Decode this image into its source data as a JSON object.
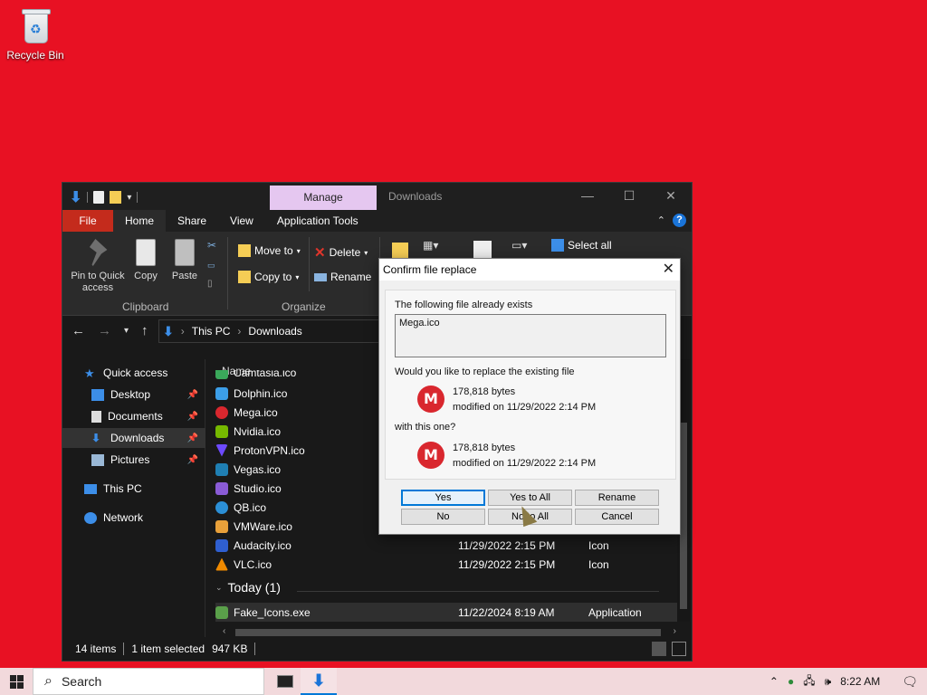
{
  "desktop": {
    "recycle_bin_label": "Recycle Bin",
    "background_color": "#e81123"
  },
  "explorer": {
    "title": "Downloads",
    "manage_tab": "Manage",
    "tabs": [
      "File",
      "Home",
      "Share",
      "View",
      "Application Tools"
    ],
    "ribbon": {
      "pin_label": "Pin to Quick access",
      "copy_label": "Copy",
      "paste_label": "Paste",
      "move_to": "Move to",
      "copy_to": "Copy to",
      "delete": "Delete",
      "rename": "Rename",
      "select_all": "Select all",
      "clipboard_group": "Clipboard",
      "organize_group": "Organize"
    },
    "address": {
      "segments": [
        "This PC",
        "Downloads"
      ]
    },
    "sidebar": {
      "items": [
        {
          "label": "Quick access",
          "icon": "star-icon"
        },
        {
          "label": "Desktop",
          "icon": "desktop-icon"
        },
        {
          "label": "Documents",
          "icon": "documents-icon"
        },
        {
          "label": "Downloads",
          "icon": "download-icon"
        },
        {
          "label": "Pictures",
          "icon": "pictures-icon"
        },
        {
          "label": "This PC",
          "icon": "computer-icon"
        },
        {
          "label": "Network",
          "icon": "network-icon"
        }
      ]
    },
    "list": {
      "column_name": "Name",
      "partial_item": "Camtasia.ico",
      "files": [
        {
          "name": "Dolphin.ico",
          "date": "",
          "type": ""
        },
        {
          "name": "Mega.ico",
          "date": "",
          "type": ""
        },
        {
          "name": "Nvidia.ico",
          "date": "",
          "type": ""
        },
        {
          "name": "ProtonVPN.ico",
          "date": "",
          "type": ""
        },
        {
          "name": "Vegas.ico",
          "date": "",
          "type": ""
        },
        {
          "name": "Studio.ico",
          "date": "",
          "type": ""
        },
        {
          "name": "QB.ico",
          "date": "",
          "type": ""
        },
        {
          "name": "VMWare.ico",
          "date": "",
          "type": ""
        },
        {
          "name": "Audacity.ico",
          "date": "11/29/2022 2:15 PM",
          "type": "Icon"
        },
        {
          "name": "VLC.ico",
          "date": "11/29/2022 2:15 PM",
          "type": "Icon"
        }
      ],
      "group_today": "Today (1)",
      "today_file": {
        "name": "Fake_Icons.exe",
        "date": "11/22/2024 8:19 AM",
        "type": "Application"
      }
    },
    "status": {
      "count": "14 items",
      "selected": "1 item selected",
      "size": "947 KB"
    }
  },
  "dialog": {
    "title": "Confirm file replace",
    "exists_text": "The following file already exists",
    "filename": "Mega.ico",
    "replace_question": "Would you like to replace the existing file",
    "existing": {
      "size": "178,818 bytes",
      "modified": "modified on 11/29/2022 2:14 PM"
    },
    "with_text": "with this one?",
    "incoming": {
      "size": "178,818 bytes",
      "modified": "modified on 11/29/2022 2:14 PM"
    },
    "buttons": {
      "yes": "Yes",
      "yes_to_all": "Yes to All",
      "rename": "Rename",
      "no": "No",
      "no_to_all": "No to All",
      "cancel": "Cancel"
    }
  },
  "taskbar": {
    "search_placeholder": "Search",
    "time": "8:22 AM"
  }
}
